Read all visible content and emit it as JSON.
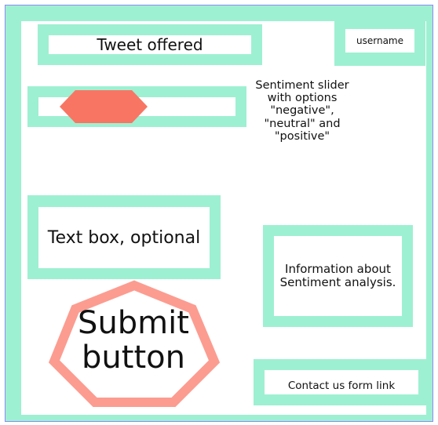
{
  "tweet": {
    "label": "Tweet offered"
  },
  "user": {
    "label": "username"
  },
  "slider": {
    "note": "Sentiment slider with options \"negative\", \"neutral\" and \"positive\""
  },
  "textbox": {
    "label": "Text box, optional"
  },
  "info": {
    "label": "Information about Sentiment analysis."
  },
  "submit": {
    "label_line1": "Submit",
    "label_line2": "button"
  },
  "contact": {
    "label": "Contact us form link"
  },
  "colors": {
    "frame": "#9ef0d2",
    "handle": "#f97563",
    "submit_outline": "#fc9c90",
    "border": "#8b8bf0"
  }
}
